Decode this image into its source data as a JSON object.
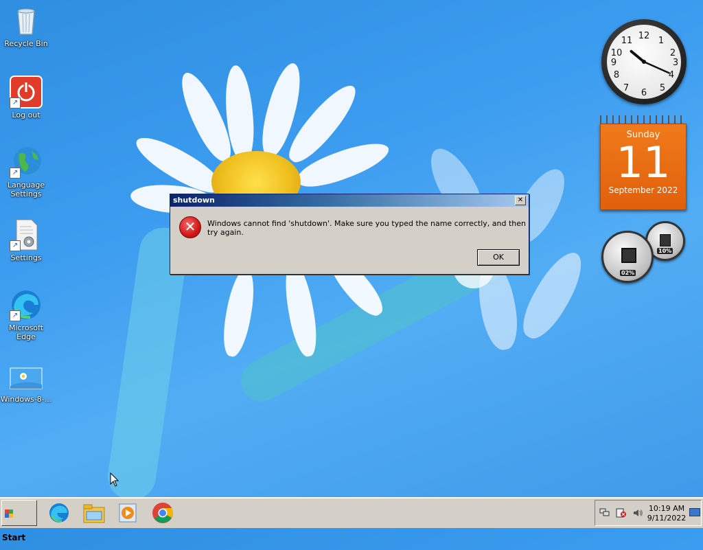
{
  "desktop": {
    "icons": [
      {
        "label": "Recycle Bin",
        "icon": "recycle-bin-icon"
      },
      {
        "label": "Log out",
        "icon": "power-icon"
      },
      {
        "label": "Language Settings",
        "icon": "globe-icon"
      },
      {
        "label": "Settings",
        "icon": "settings-document-icon"
      },
      {
        "label": "Microsoft Edge",
        "icon": "edge-icon"
      },
      {
        "label": "Windows-8-...",
        "icon": "image-file-icon"
      }
    ]
  },
  "dialog": {
    "title": "shutdown",
    "close_glyph": "✕",
    "message": "Windows cannot find 'shutdown'. Make sure you typed the name correctly, and then try again.",
    "ok_label": "OK",
    "icon": "error-icon"
  },
  "gadgets": {
    "clock": {
      "hour": 10,
      "minute": 19
    },
    "calendar": {
      "weekday": "Sunday",
      "day": "11",
      "month_year": "September 2022"
    },
    "meter": {
      "cpu": "02%",
      "memory": "10%"
    }
  },
  "taskbar": {
    "start_label": "Start",
    "apps": [
      "edge-icon",
      "file-explorer-icon",
      "media-player-icon",
      "chrome-icon"
    ],
    "tray": {
      "time": "10:19 AM",
      "date": "9/11/2022"
    }
  },
  "colors": {
    "desktop_bg": "#3c9cef",
    "dialog_titlebar": "#0a246a",
    "calendar_orange": "#e8680f",
    "taskbar_bg": "#d4d0c8"
  }
}
